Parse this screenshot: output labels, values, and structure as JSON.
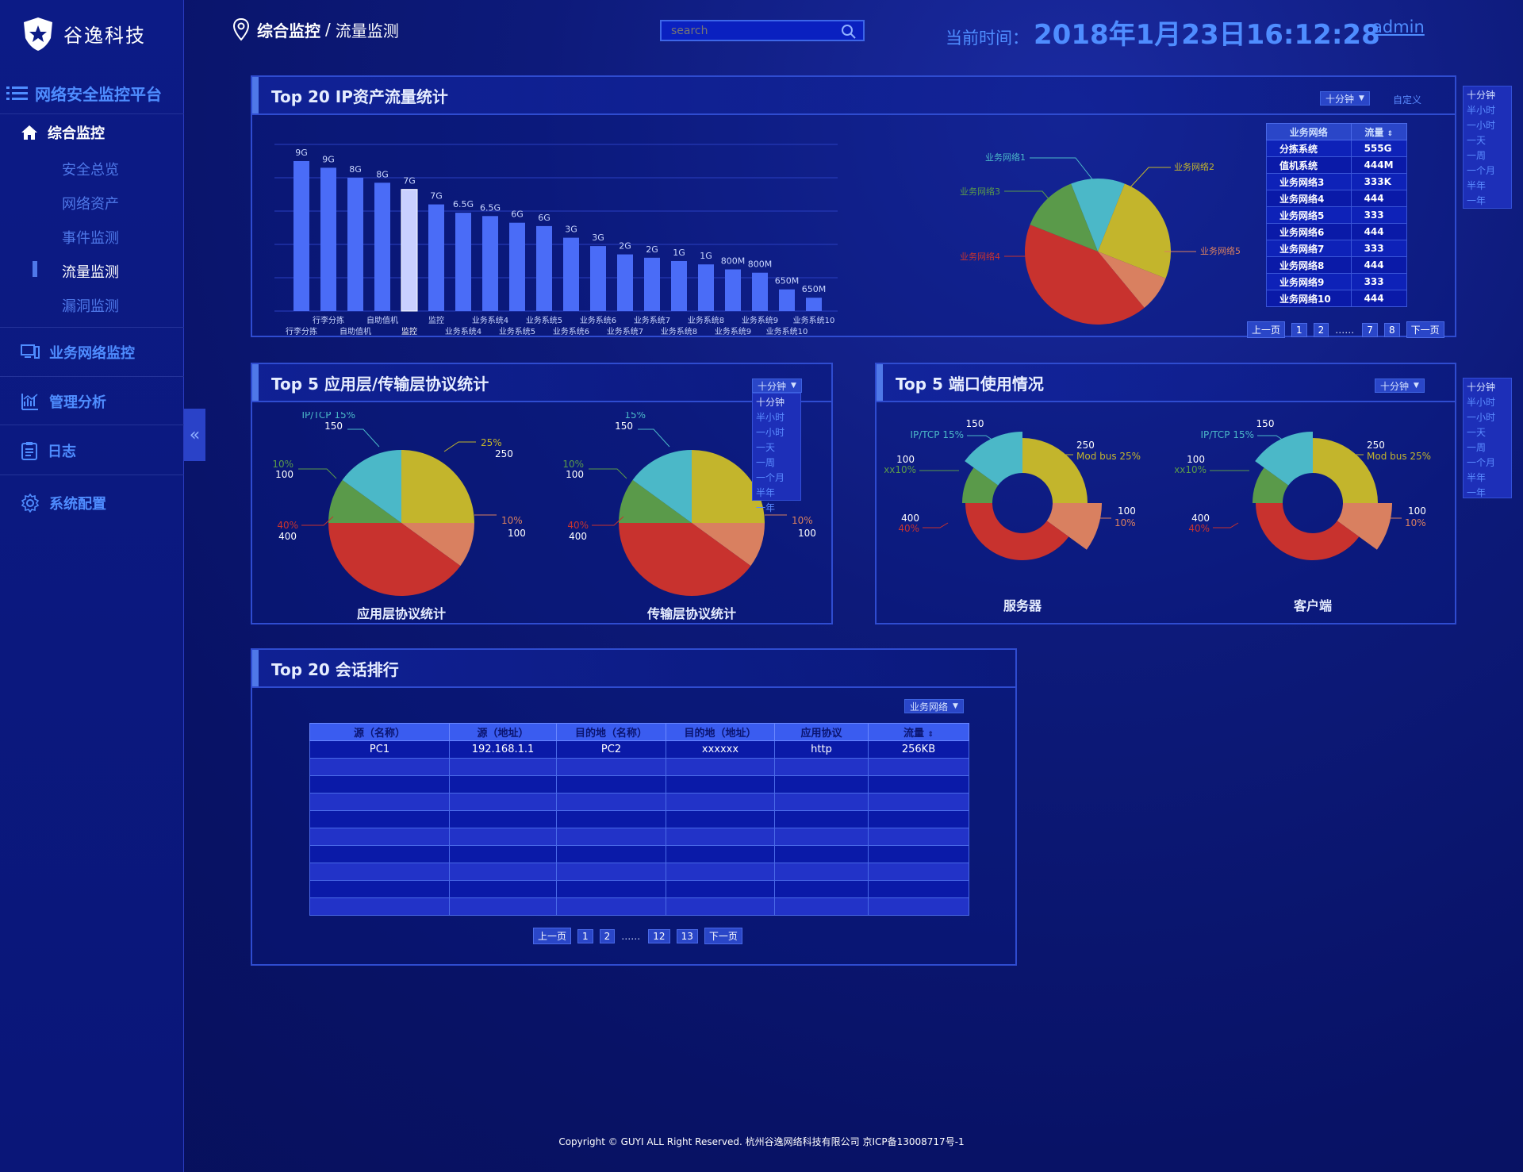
{
  "brand": {
    "name": "谷逸科技"
  },
  "platform": {
    "title": "网络安全监控平台"
  },
  "nav": {
    "sections": [
      {
        "label": "综合监控"
      },
      {
        "label": "业务网络监控"
      },
      {
        "label": "管理分析"
      },
      {
        "label": "日志"
      },
      {
        "label": "系统配置"
      }
    ],
    "sub_items": [
      "安全总览",
      "网络资产",
      "事件监测",
      "流量监测",
      "漏洞监测"
    ],
    "active_sub": "流量监测"
  },
  "breadcrumb": {
    "parent": "综合监控",
    "separator": "/",
    "current": "流量监测"
  },
  "search": {
    "placeholder": "search"
  },
  "clock": {
    "label": "当前时间：",
    "value": "2018年1月23日16:12:28"
  },
  "user": {
    "name": "admin"
  },
  "colors": {
    "accent": "#4f8dff",
    "bar": "#4a6cf7",
    "pie_yellow": "#c3b52c",
    "pie_teal": "#4bb8c8",
    "pie_green": "#5a9a4a",
    "pie_red": "#c8322e",
    "pie_salmon": "#d98060"
  },
  "panel_ip": {
    "title": "Top 20 IP资产流量统计",
    "dropdown": "十分钟",
    "custom_link": "自定义",
    "side_menu": [
      "十分钟",
      "半小时",
      "一小时",
      "一天",
      "一周",
      "一个月",
      "半年",
      "一年"
    ],
    "bar_labels": [
      "9G",
      "9G",
      "8G",
      "8G",
      "7G",
      "7G",
      "6.5G",
      "6.5G",
      "6G",
      "6G",
      "3G",
      "3G",
      "2G",
      "2G",
      "1G",
      "1G",
      "800M",
      "800M",
      "650M",
      "650M"
    ],
    "x_top": [
      "行李分拣",
      "自助值机",
      "监控",
      "业务系统4",
      "业务系统5",
      "业务系统6",
      "业务系统7",
      "业务系统8",
      "业务系统9",
      "业务系统10"
    ],
    "x_bottom": [
      "行李分拣",
      "自助值机",
      "监控",
      "业务系统4",
      "业务系统5",
      "业务系统6",
      "业务系统7",
      "业务系统8",
      "业务系统9",
      "业务系统10"
    ],
    "pie_labels": [
      "业务网络1",
      "业务网络2",
      "业务网络3",
      "业务网络4",
      "业务网络5"
    ],
    "table": {
      "headers": [
        "业务网络",
        "流量"
      ],
      "rows": [
        [
          "分拣系统",
          "555G"
        ],
        [
          "值机系统",
          "444M"
        ],
        [
          "业务网络3",
          "333K"
        ],
        [
          "业务网络4",
          "444"
        ],
        [
          "业务网络5",
          "333"
        ],
        [
          "业务网络6",
          "444"
        ],
        [
          "业务网络7",
          "333"
        ],
        [
          "业务网络8",
          "444"
        ],
        [
          "业务网络9",
          "333"
        ],
        [
          "业务网络10",
          "444"
        ]
      ]
    },
    "pager": {
      "prev": "上一页",
      "p1": "1",
      "p2": "2",
      "dots": "……",
      "p7": "7",
      "p8": "8",
      "next": "下一页"
    }
  },
  "panel_proto": {
    "title": "Top 5 应用层/传输层协议统计",
    "dropdown": "十分钟",
    "menu": [
      "十分钟",
      "半小时",
      "一小时",
      "一天",
      "一周",
      "一个月",
      "半年",
      "一年"
    ],
    "pie1": {
      "caption": "应用层协议统计",
      "l_teal_pct": "IP/TCP 15%",
      "l_teal_val": "150",
      "l_yellow_pct": "25%",
      "l_yellow_val": "250",
      "l_green_pct": "10%",
      "l_green_val": "100",
      "l_red_pct": "40%",
      "l_red_val": "400",
      "l_salmon_pct": "10%",
      "l_salmon_val": "100"
    },
    "pie2": {
      "caption": "传输层协议统计",
      "l_teal_pct": "15%",
      "l_teal_val": "150",
      "l_green_pct": "10%",
      "l_green_val": "100",
      "l_red_pct": "40%",
      "l_red_val": "400",
      "l_salmon_pct": "10%",
      "l_salmon_val": "100"
    }
  },
  "panel_port": {
    "title": "Top 5 端口使用情况",
    "dropdown": "十分钟",
    "side_menu": [
      "十分钟",
      "半小时",
      "一小时",
      "一天",
      "一周",
      "一个月",
      "半年",
      "一年"
    ],
    "donut1": {
      "caption": "服务器"
    },
    "donut2": {
      "caption": "客户端"
    },
    "labels": {
      "teal_val": "150",
      "teal_pct": "IP/TCP 15%",
      "yellow_val": "250",
      "yellow_pct": "Mod bus 25%",
      "green_val": "100",
      "green_pct": "xxx10%",
      "red_val": "400",
      "red_pct": "40%",
      "salmon_val": "100",
      "salmon_pct": "10%"
    }
  },
  "panel_session": {
    "title": "Top 20 会话排行",
    "dropdown": "业务网络",
    "headers": [
      "源（名称）",
      "源（地址）",
      "目的地（名称）",
      "目的地（地址）",
      "应用协议",
      "流量"
    ],
    "rows": [
      [
        "PC1",
        "192.168.1.1",
        "PC2",
        "xxxxxx",
        "http",
        "256KB"
      ]
    ],
    "pager": {
      "prev": "上一页",
      "p1": "1",
      "p2": "2",
      "dots": "……",
      "p12": "12",
      "p13": "13",
      "next": "下一页"
    }
  },
  "chart_data": [
    {
      "type": "bar",
      "title": "Top 20 IP资产流量统计",
      "categories": [
        "1",
        "2",
        "3",
        "4",
        "5",
        "6",
        "7",
        "8",
        "9",
        "10",
        "11",
        "12",
        "13",
        "14",
        "15",
        "16",
        "17",
        "18",
        "19",
        "20"
      ],
      "values": [
        9,
        8.6,
        8,
        7.7,
        7.3,
        6.4,
        5.9,
        5.7,
        5.3,
        5.1,
        4.4,
        3.9,
        3.4,
        3.2,
        3.0,
        2.8,
        2.5,
        2.3,
        1.3,
        0.8
      ],
      "highlight_index": 4,
      "ylim": [
        0,
        10
      ]
    },
    {
      "type": "pie",
      "labels": [
        "业务网络1",
        "业务网络2",
        "业务网络3",
        "业务网络4",
        "业务网络5"
      ],
      "values": [
        12,
        25,
        13,
        42,
        8
      ]
    },
    {
      "type": "pie",
      "title": "应用层协议统计",
      "values": [
        15,
        25,
        10,
        40,
        10
      ]
    },
    {
      "type": "pie",
      "title": "传输层协议统计",
      "values": [
        15,
        25,
        10,
        40,
        10
      ]
    },
    {
      "type": "pie",
      "title": "服务器",
      "values": [
        15,
        25,
        10,
        40,
        10
      ]
    },
    {
      "type": "pie",
      "title": "客户端",
      "values": [
        15,
        25,
        10,
        40,
        10
      ]
    }
  ],
  "footer": {
    "text": "Copyright © GUYI  ALL Right Reserved. 杭州谷逸网络科技有限公司 京ICP备13008717号-1"
  }
}
